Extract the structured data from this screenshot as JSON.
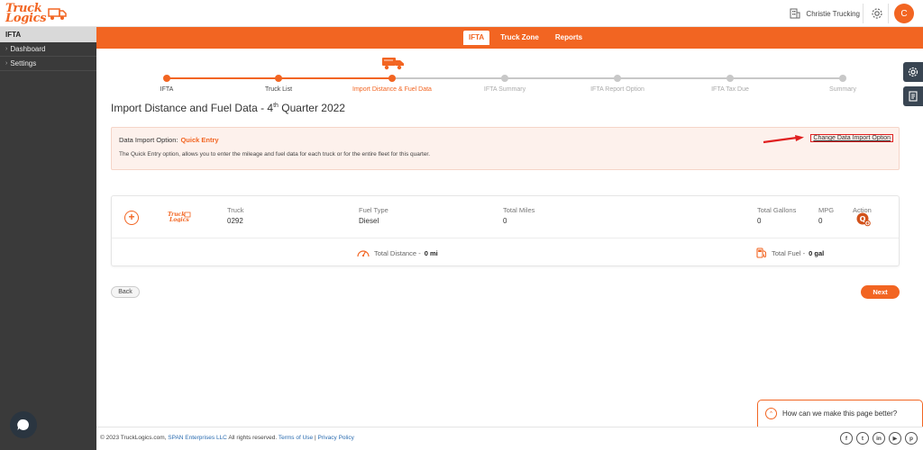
{
  "header": {
    "logo_line1": "Truck",
    "logo_line2": "Logics",
    "company_name": "Christie Trucking",
    "avatar_initial": "C"
  },
  "sidebar": {
    "section": "IFTA",
    "items": [
      {
        "label": "Dashboard"
      },
      {
        "label": "Settings"
      }
    ]
  },
  "nav": {
    "tabs": [
      {
        "label": "IFTA",
        "active": true
      },
      {
        "label": "Truck Zone",
        "active": false
      },
      {
        "label": "Reports",
        "active": false
      }
    ]
  },
  "stepper": {
    "steps": [
      {
        "label": "IFTA",
        "state": "done"
      },
      {
        "label": "Truck List",
        "state": "done"
      },
      {
        "label": "Import Distance & Fuel Data",
        "state": "current"
      },
      {
        "label": "IFTA Summary",
        "state": "pending"
      },
      {
        "label": "IFTA Report Option",
        "state": "pending"
      },
      {
        "label": "IFTA Tax Due",
        "state": "pending"
      },
      {
        "label": "Summary",
        "state": "pending"
      }
    ],
    "colors": {
      "active": "#f26522",
      "pending": "#c8c8c8"
    }
  },
  "page": {
    "title_prefix": "Import Distance and Fuel Data - 4",
    "title_sup": "th",
    "title_suffix": " Quarter 2022"
  },
  "import_option": {
    "label": "Data Import Option:",
    "value": "Quick Entry",
    "description": "The Quick Entry option, allows you to enter the mileage and fuel data for each truck or for the entire fleet for this quarter.",
    "change_link": "Change Data Import Option"
  },
  "truck_card": {
    "columns": {
      "truck": {
        "header": "Truck",
        "value": "0292"
      },
      "fuel_type": {
        "header": "Fuel Type",
        "value": "Diesel"
      },
      "total_miles": {
        "header": "Total Miles",
        "value": "0"
      },
      "total_gallons": {
        "header": "Total Gallons",
        "value": "0"
      },
      "mpg": {
        "header": "MPG",
        "value": "0"
      },
      "action": {
        "header": "Action"
      }
    },
    "total_distance_label": "Total Distance - ",
    "total_distance_value": "0 mi",
    "total_fuel_label": "Total Fuel - ",
    "total_fuel_value": "0 gal",
    "add_symbol": "+"
  },
  "buttons": {
    "back": "Back",
    "next": "Next"
  },
  "footer": {
    "copyright": "© 2023 TruckLogics.com, ",
    "company_link": "SPAN Enterprises LLC",
    "rights": " All rights reserved. ",
    "terms": "Terms of Use",
    "separator": " | ",
    "privacy": "Privacy Policy",
    "socials": [
      "f",
      "t",
      "in",
      "▶",
      "p"
    ]
  },
  "feedback": {
    "text": "How can we make this page better?"
  },
  "brand_color": "#f26522"
}
